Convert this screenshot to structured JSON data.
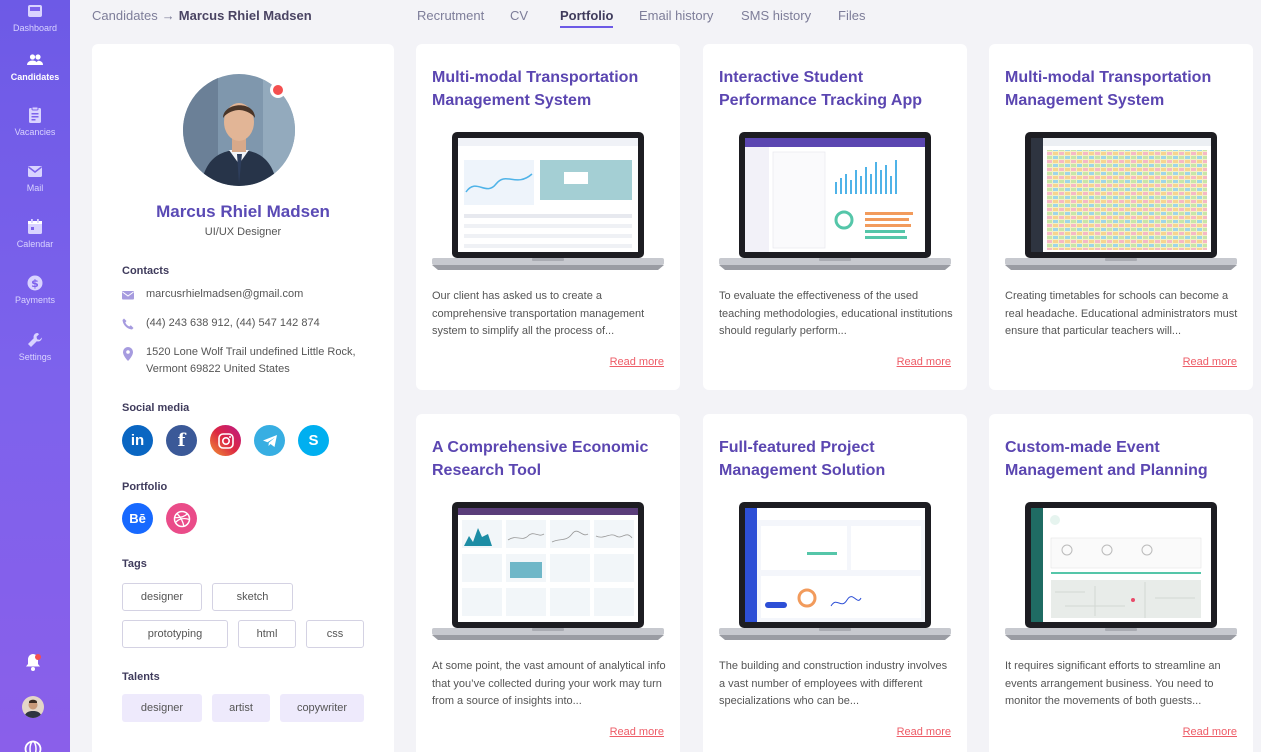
{
  "sidebar": {
    "items": [
      {
        "label": "Dashboard",
        "icon": "dashboard-icon"
      },
      {
        "label": "Candidates",
        "icon": "candidates-icon"
      },
      {
        "label": "Vacancies",
        "icon": "clipboard-icon"
      },
      {
        "label": "Mail",
        "icon": "mail-icon"
      },
      {
        "label": "Calendar",
        "icon": "calendar-icon"
      },
      {
        "label": "Payments",
        "icon": "dollar-icon"
      },
      {
        "label": "Settings",
        "icon": "wrench-icon"
      }
    ],
    "active": "Candidates"
  },
  "breadcrumb": {
    "root": "Candidates",
    "arrow": "→",
    "current": "Marcus Rhiel Madsen"
  },
  "tabs": [
    {
      "label": "Recrutment"
    },
    {
      "label": "CV"
    },
    {
      "label": "Portfolio"
    },
    {
      "label": "Email history"
    },
    {
      "label": "SMS history"
    },
    {
      "label": "Files"
    }
  ],
  "active_tab": "Portfolio",
  "profile": {
    "name": "Marcus Rhiel Madsen",
    "role": "UI/UX Designer",
    "contacts_title": "Contacts",
    "email": "marcusrhielmadsen@gmail.com",
    "phones": "(44) 243 638 912, (44) 547 142 874",
    "address": "1520 Lone Wolf Trail undefined Little Rock, Vermont 69822 United States",
    "social_title": "Social media",
    "social": [
      {
        "name": "linkedin",
        "glyph": "in",
        "color": "#0a66c2"
      },
      {
        "name": "facebook",
        "glyph": "f",
        "color": "#3b5998"
      },
      {
        "name": "instagram",
        "glyph": "",
        "color": "#d6249f"
      },
      {
        "name": "telegram",
        "glyph": "",
        "color": "#37aee2"
      },
      {
        "name": "skype",
        "glyph": "S",
        "color": "#00aff0"
      }
    ],
    "portfolio_title": "Portfolio",
    "portfolio_links": [
      {
        "name": "behance",
        "glyph": "Bē",
        "color": "#1769ff"
      },
      {
        "name": "dribbble",
        "glyph": "",
        "color": "#ea4c89"
      }
    ],
    "tags_title": "Tags",
    "tags": [
      "designer",
      "sketch",
      "prototyping",
      "html",
      "css"
    ],
    "talents_title": "Talents",
    "talents": [
      "designer",
      "artist",
      "copywriter"
    ]
  },
  "projects": [
    {
      "title": "Multi-modal Transportation Management System",
      "desc": "Our client has asked us to create a comprehensive transportation management system to simplify all the process of...",
      "read_more": "Read more"
    },
    {
      "title": "Interactive Student Performance Tracking App",
      "desc": "To evaluate the effectiveness of the used teaching methodologies, educational institutions should regularly perform...",
      "read_more": "Read more"
    },
    {
      "title": "Multi-modal Transportation Management System",
      "desc": "Creating timetables for schools can become a real headache. Educational administrators must ensure that particular teachers will...",
      "read_more": "Read more"
    },
    {
      "title": "A Comprehensive Economic Research Tool",
      "desc": "At some point, the vast amount of analytical info that you’ve collected during your work may turn from a source of insights into...",
      "read_more": "Read more"
    },
    {
      "title": "Full-featured Project Management Solution",
      "desc": "The building and construction industry involves a vast number of employees with different specializations who can be...",
      "read_more": "Read more"
    },
    {
      "title": "Custom-made Event Management and Planning",
      "desc": "It requires significant efforts to streamline an events arrangement business. You need to monitor the movements of both guests...",
      "read_more": "Read more"
    }
  ],
  "colors": {
    "accent": "#6d5ae6",
    "title": "#5b46b1",
    "link": "#ee5c67"
  }
}
